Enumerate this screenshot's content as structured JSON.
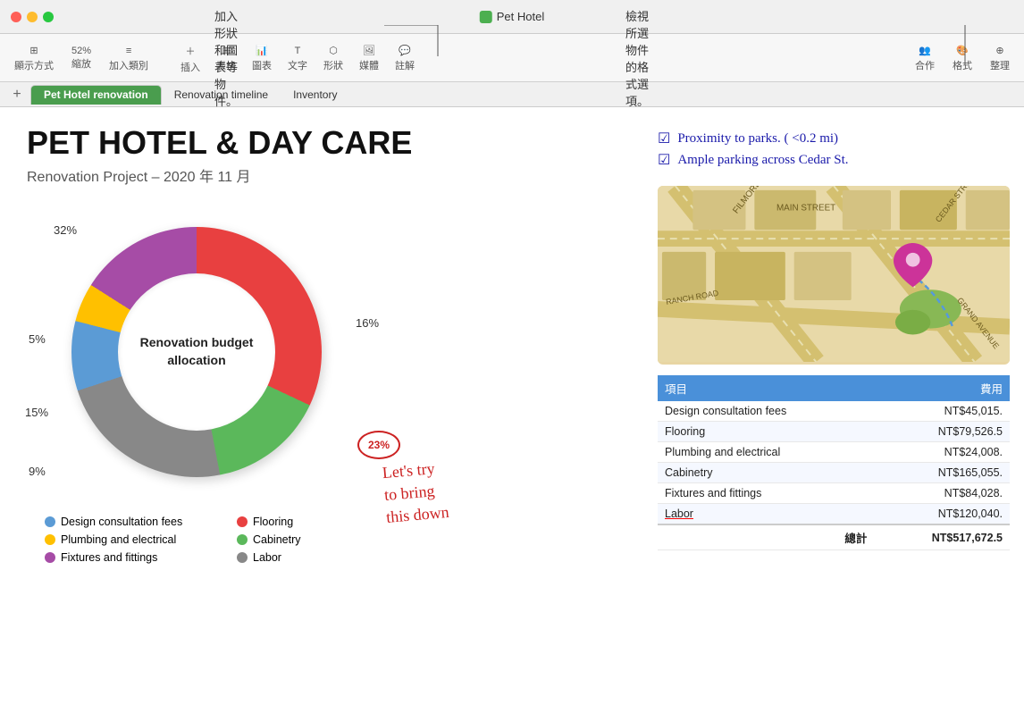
{
  "window": {
    "title": "Pet Hotel",
    "traffic_lights": [
      "red",
      "yellow",
      "green"
    ]
  },
  "toolbar": {
    "view_label": "顯示方式",
    "zoom_label": "縮放",
    "zoom_value": "52%",
    "add_category_label": "加入類別",
    "insert_label": "插入",
    "table_label": "表格",
    "chart_label": "圖表",
    "text_label": "文字",
    "shape_label": "形狀",
    "media_label": "媒體",
    "comment_label": "註解",
    "collaborate_label": "合作",
    "format_label": "格式",
    "organize_label": "整理"
  },
  "tabs": [
    {
      "label": "Pet Hotel renovation",
      "active": true
    },
    {
      "label": "Renovation timeline",
      "active": false
    },
    {
      "label": "Inventory",
      "active": false
    }
  ],
  "annotations": {
    "top_left": "加入形狀和圖表等物件。",
    "top_right": "檢視所選物件的格式選項。"
  },
  "document": {
    "title": "PET HOTEL & DAY CARE",
    "subtitle": "Renovation Project – 2020 年 11 月",
    "chart": {
      "title": "Renovation budget allocation",
      "segments": [
        {
          "label": "Design consultation fees",
          "percent": 9,
          "color": "#5b9bd5"
        },
        {
          "label": "Plumbing and electrical",
          "percent": 5,
          "color": "#ffc000"
        },
        {
          "label": "Fixtures and fittings",
          "percent": 16,
          "color": "#a64ca6"
        },
        {
          "label": "Flooring",
          "percent": 32,
          "color": "#e84040"
        },
        {
          "label": "Cabinetry",
          "percent": 15,
          "color": "#5bb85b"
        },
        {
          "label": "Labor",
          "percent": 23,
          "color": "#888"
        }
      ],
      "labels": {
        "top": "32%",
        "left_top": "5%",
        "left_mid": "15%",
        "left_bot": "9%",
        "right": "16%",
        "bottom_right": "23%"
      }
    },
    "legend": [
      {
        "label": "Design consultation fees",
        "color": "#5b9bd5"
      },
      {
        "label": "Flooring",
        "color": "#e84040"
      },
      {
        "label": "Plumbing and electrical",
        "color": "#ffc000"
      },
      {
        "label": "Cabinetry",
        "color": "#5bb85b"
      },
      {
        "label": "Fixtures and fittings",
        "color": "#a64ca6"
      },
      {
        "label": "Labor",
        "color": "#888"
      }
    ]
  },
  "checklist": {
    "items": [
      {
        "text": "Proximity to parks. ( <0.2 mi)"
      },
      {
        "text": "Ample parking across Cedar St."
      }
    ]
  },
  "table": {
    "headers": [
      "項目",
      "費用"
    ],
    "rows": [
      {
        "item": "Design consultation fees",
        "cost": "NT$45,015."
      },
      {
        "item": "Flooring",
        "cost": "NT$79,526.5"
      },
      {
        "item": "Plumbing and electrical",
        "cost": "NT$24,008."
      },
      {
        "item": "Cabinetry",
        "cost": "NT$165,055."
      },
      {
        "item": "Fixtures and fittings",
        "cost": "NT$84,028."
      },
      {
        "item": "Labor",
        "cost": "NT$120,040."
      }
    ],
    "total_label": "總計",
    "total_value": "NT$517,672.5"
  },
  "handwriting": {
    "text": "Let's try\nto bring\nthis down",
    "circled_label": "23%"
  }
}
